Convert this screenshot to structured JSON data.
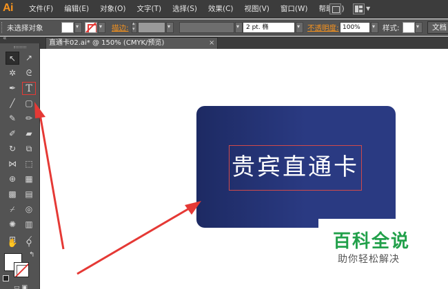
{
  "app": {
    "logo": "Ai",
    "menu": [
      "文件(F)",
      "编辑(E)",
      "对象(O)",
      "文字(T)",
      "选择(S)",
      "效果(C)",
      "视图(V)",
      "窗口(W)",
      "帮助(H)"
    ]
  },
  "control_bar": {
    "selection_status": "未选择对象",
    "stroke_label": "描边:",
    "brush_value": "2 pt. 椭",
    "opacity_label": "不透明度:",
    "opacity_value": "100%",
    "style_label": "样式:",
    "doc_setup_label": "文档"
  },
  "document_tab": {
    "title": "直通卡02.ai* @ 150% (CMYK/预览)",
    "close_glyph": "×"
  },
  "toolbox": {
    "collapse_glyph": "«",
    "tools": [
      {
        "name": "selection-tool",
        "glyph": "↖"
      },
      {
        "name": "direct-selection-tool",
        "glyph": "↗"
      },
      {
        "name": "magic-wand-tool",
        "glyph": "✲"
      },
      {
        "name": "lasso-tool",
        "glyph": "ᘓ"
      },
      {
        "name": "pen-tool",
        "glyph": "✒"
      },
      {
        "name": "type-tool",
        "glyph": "T"
      },
      {
        "name": "line-segment-tool",
        "glyph": "╱"
      },
      {
        "name": "rounded-rectangle-tool",
        "glyph": "▢"
      },
      {
        "name": "paintbrush-tool",
        "glyph": "✎"
      },
      {
        "name": "pencil-tool",
        "glyph": "✏"
      },
      {
        "name": "blob-brush-tool",
        "glyph": "✐"
      },
      {
        "name": "eraser-tool",
        "glyph": "▰"
      },
      {
        "name": "rotate-tool",
        "glyph": "↻"
      },
      {
        "name": "scale-tool",
        "glyph": "⧉"
      },
      {
        "name": "width-tool",
        "glyph": "⋈"
      },
      {
        "name": "free-transform-tool",
        "glyph": "⬚"
      },
      {
        "name": "shape-builder-tool",
        "glyph": "⊕"
      },
      {
        "name": "perspective-grid-tool",
        "glyph": "▦"
      },
      {
        "name": "mesh-tool",
        "glyph": "▩"
      },
      {
        "name": "gradient-tool",
        "glyph": "▤"
      },
      {
        "name": "eyedropper-tool",
        "glyph": "⌿"
      },
      {
        "name": "blend-tool",
        "glyph": "◎"
      },
      {
        "name": "symbol-sprayer-tool",
        "glyph": "✺"
      },
      {
        "name": "column-graph-tool",
        "glyph": "▥"
      },
      {
        "name": "artboard-tool",
        "glyph": "⊞"
      },
      {
        "name": "slice-tool",
        "glyph": "⟋"
      },
      {
        "name": "hand-tool",
        "glyph": "✋"
      },
      {
        "name": "zoom-tool",
        "glyph": "⚲"
      }
    ],
    "swap_glyph": "↰",
    "mode_glyphs": "▭ ▣"
  },
  "artboard": {
    "card_text": "贵宾直通卡",
    "card_color": "#27367a"
  },
  "watermark": {
    "title": "百科全说",
    "subtitle": "助你轻松解决"
  },
  "colors": {
    "accent_orange": "#f7931e",
    "annotation_red": "#e53935",
    "watermark_green": "#21a04a"
  }
}
